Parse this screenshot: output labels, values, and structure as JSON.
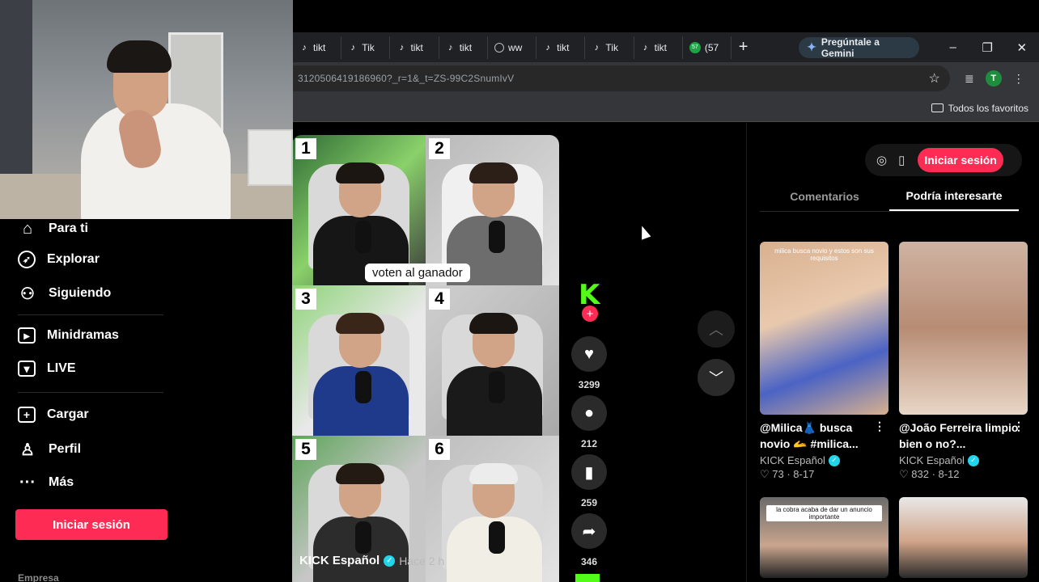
{
  "browser": {
    "tabs": [
      {
        "label": "tikt",
        "icon": "tiktok-icon"
      },
      {
        "label": "Tik",
        "icon": "tiktok-icon"
      },
      {
        "label": "tikt",
        "icon": "tiktok-icon"
      },
      {
        "label": "tikt",
        "icon": "tiktok-icon"
      },
      {
        "label": "ww",
        "icon": "globe-icon"
      },
      {
        "label": "tikt",
        "icon": "tiktok-icon"
      },
      {
        "label": "Tik",
        "icon": "tiktok-icon"
      },
      {
        "label": "tikt",
        "icon": "tiktok-icon"
      },
      {
        "label": "(57",
        "icon": "badge-icon",
        "badge": "57"
      }
    ],
    "gemini_label": "Pregúntale a Gemini",
    "url": "3120506419186960?_r=1&_t=ZS-99C2SnumIvV",
    "profile_initial": "T",
    "bookmarks_folder": "Todos los favoritos"
  },
  "sidebar": {
    "items": [
      {
        "label": "Para ti",
        "icon": "home-icon"
      },
      {
        "label": "Explorar",
        "icon": "compass-icon"
      },
      {
        "label": "Siguiendo",
        "icon": "following-icon"
      },
      {
        "label": "Minidramas",
        "icon": "minidramas-icon"
      },
      {
        "label": "LIVE",
        "icon": "live-icon"
      },
      {
        "label": "Cargar",
        "icon": "upload-icon"
      },
      {
        "label": "Perfil",
        "icon": "profile-icon"
      },
      {
        "label": "Más",
        "icon": "more-icon"
      }
    ],
    "login_label": "Iniciar sesión",
    "footer_label": "Empresa"
  },
  "video": {
    "numbers": [
      "1",
      "2",
      "3",
      "4",
      "5",
      "6"
    ],
    "caption": "voten al ganador",
    "author": "KICK Español",
    "time": "Hace 2 h",
    "likes": "3299",
    "comments": "212",
    "saves": "259",
    "shares": "346",
    "avatar_letter": "K"
  },
  "right_panel": {
    "login_label": "Iniciar sesión",
    "tabs": [
      "Comentarios",
      "Podría interesarte"
    ],
    "active_tab": 1,
    "cards": [
      {
        "title": "@Milica👗 busca novio 🫴 #milica...",
        "author": "KICK Español",
        "stats": "♡ 73 · 8-17",
        "overlay": "milica busca novio y estos son sus requisitos"
      },
      {
        "title": "@João Ferreira limpio bien o no?...",
        "author": "KICK Español",
        "stats": "♡ 832 · 8-12",
        "overlay": ""
      },
      {
        "title": "",
        "author": "",
        "stats": "",
        "overlay": "la cobra acaba de dar un anuncio importante"
      },
      {
        "title": "",
        "author": "",
        "stats": "",
        "overlay": ""
      }
    ]
  }
}
